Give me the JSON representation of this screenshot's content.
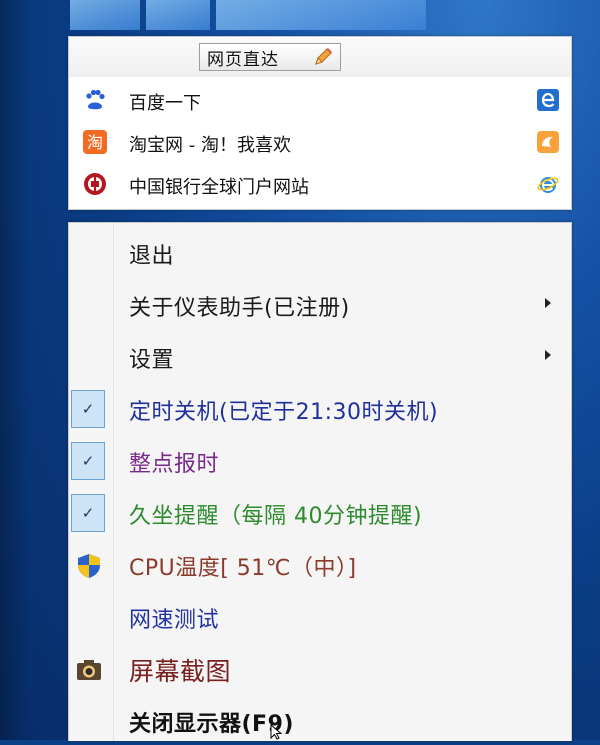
{
  "quick_panel": {
    "nav_button_label": "网页直达",
    "sites": [
      {
        "label": "百度一下",
        "icon": "baidu-paw-icon",
        "browser_icon": "ie-edge-icon"
      },
      {
        "label": "淘宝网 - 淘！我喜欢",
        "icon": "taobao-icon",
        "browser_icon": "uc-browser-icon"
      },
      {
        "label": "中国银行全球门户网站",
        "icon": "bank-of-china-icon",
        "browser_icon": "internet-explorer-icon"
      }
    ]
  },
  "menu": {
    "items": [
      {
        "label": "退出",
        "color": "#1a1a1a"
      },
      {
        "label": "关于仪表助手(已注册)",
        "color": "#1a1a1a",
        "submenu": true
      },
      {
        "label": "设置",
        "color": "#1a1a1a",
        "submenu": true
      },
      {
        "label": "定时关机(已定于21:30时关机)",
        "color": "#1f2f9c",
        "checked": true
      },
      {
        "label": "整点报时",
        "color": "#7a2a8c",
        "checked": true
      },
      {
        "label": "久坐提醒（每隔 40分钟提醒)",
        "color": "#2d8a2d",
        "checked": true
      },
      {
        "label": "CPU温度[ 51℃（中）]",
        "color": "#8a3a2a",
        "icon": "shield-icon"
      },
      {
        "label": "网速测试",
        "color": "#2233a0"
      },
      {
        "label": "屏幕截图",
        "color": "#7a1f1f",
        "icon": "camera-icon"
      },
      {
        "label": "关闭显示器(F9)",
        "color": "#111111",
        "bold": true
      }
    ]
  },
  "colors": {
    "desktop_blue": "#0a3b82",
    "check_highlight": "#cde4f7"
  }
}
